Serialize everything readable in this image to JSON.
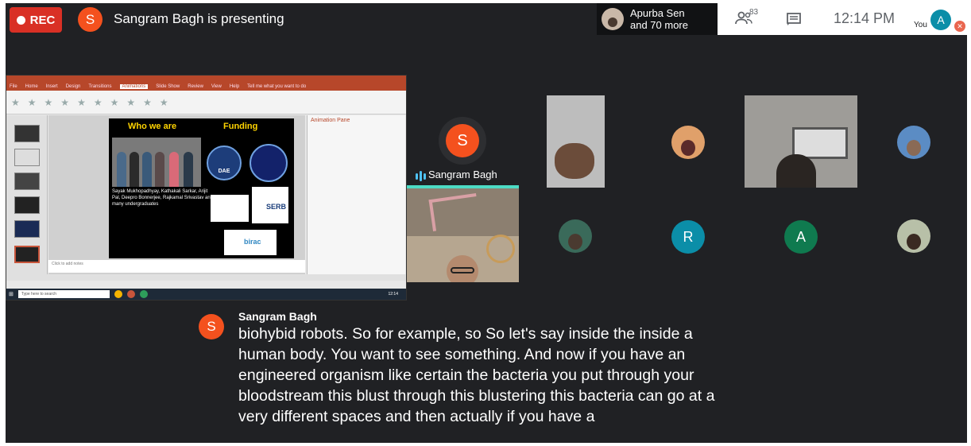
{
  "topbar": {
    "rec_label": "REC",
    "presenter_initial": "S",
    "presenting_text": "Sangram Bagh is presenting",
    "people_chip_line1": "Apurba Sen",
    "people_chip_line2": "and 70 more",
    "people_count": "83",
    "clock": "12:14 PM",
    "you_label": "You",
    "you_initial": "A"
  },
  "shared_screen": {
    "ppt_tabs": [
      "File",
      "Home",
      "Insert",
      "Design",
      "Transitions",
      "Animations",
      "Slide Show",
      "Review",
      "View",
      "Help",
      "Tell me what you want to do"
    ],
    "active_tab": "Animations",
    "slide": {
      "heading_left": "Who we are",
      "heading_right": "Funding",
      "logo_dae": "DAE",
      "names": "Sayak Mukhopadhyay, Kathakali Sarkar, Arijit Pal, Deepro Bonnerjee, Rajkamal Srivastav and many undergraduates",
      "serb": "SERB",
      "birac": "birac"
    },
    "animation_pane_title": "Animation Pane",
    "notes_text": "Click to add notes",
    "taskbar_search": "Type here to search",
    "taskbar_clock": "12:14"
  },
  "participants": {
    "active_speaker": {
      "initial": "S",
      "name": "Sangram Bagh"
    },
    "tiles": [
      {
        "initial": "R",
        "color": "#0b8ea8"
      },
      {
        "initial": "A",
        "color": "#0f7a4f"
      }
    ]
  },
  "caption": {
    "speaker_initial": "S",
    "speaker_name": "Sangram Bagh",
    "lines": [
      "biohybid robots. So for example, so So let's say inside the inside a",
      "human body. You want to see something. And now if you have an",
      "engineered organism like certain the bacteria you put through your",
      "bloodstream this blust through this blustering this bacteria can go at a",
      "very different spaces and then actually if you have a"
    ]
  }
}
